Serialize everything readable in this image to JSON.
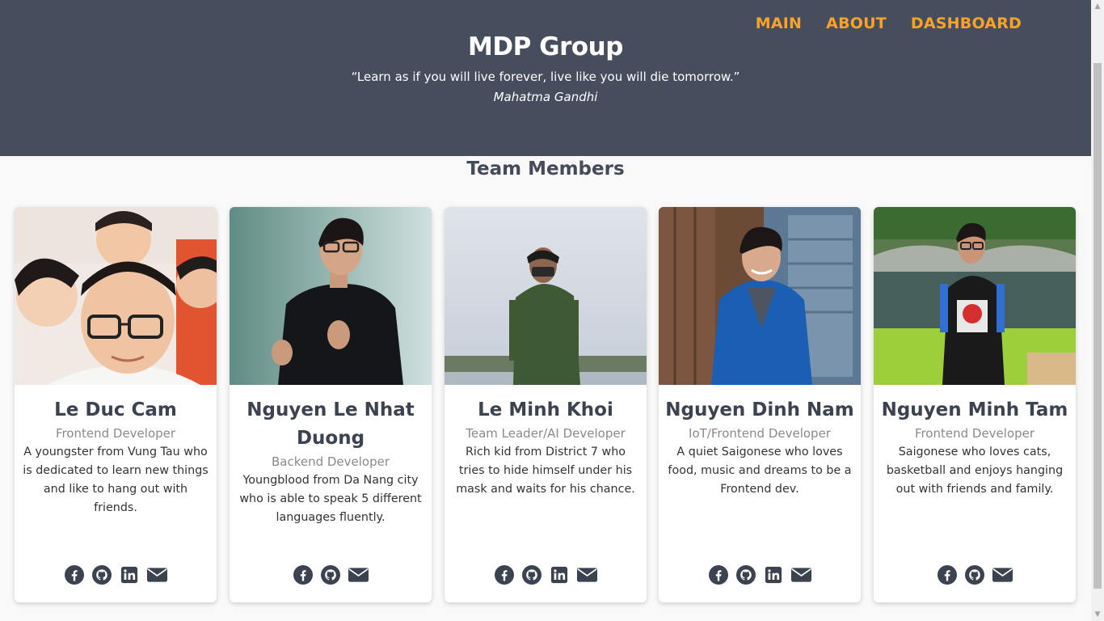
{
  "nav": {
    "items": [
      {
        "label": "MAIN"
      },
      {
        "label": "ABOUT"
      },
      {
        "label": "DASHBOARD"
      }
    ]
  },
  "header": {
    "title": "MDP Group",
    "quote": "“Learn as if you will live forever, live like you will die tomorrow.”",
    "author": "Mahatma Gandhi"
  },
  "team": {
    "title": "Team Members",
    "members": [
      {
        "name": "Le Duc Cam",
        "role": "Frontend Developer",
        "description": "A youngster from Vung Tau who is dedicated to learn new things and like to hang out with friends.",
        "socials": [
          "facebook-icon",
          "github-icon",
          "linkedin-icon",
          "email-icon"
        ]
      },
      {
        "name": "Nguyen Le Nhat Duong",
        "role": "Backend Developer",
        "description": "Youngblood from Da Nang city who is able to speak 5 different languages fluently.",
        "socials": [
          "facebook-icon",
          "github-icon",
          "email-icon"
        ]
      },
      {
        "name": "Le Minh Khoi",
        "role": "Team Leader/AI Developer",
        "description": "Rich kid from District 7 who tries to hide himself under his mask and waits for his chance.",
        "socials": [
          "facebook-icon",
          "github-icon",
          "linkedin-icon",
          "email-icon"
        ]
      },
      {
        "name": "Nguyen Dinh Nam",
        "role": "IoT/Frontend Developer",
        "description": "A quiet Saigonese who loves food, music and dreams to be a Frontend dev.",
        "socials": [
          "facebook-icon",
          "github-icon",
          "linkedin-icon",
          "email-icon"
        ]
      },
      {
        "name": "Nguyen Minh Tam",
        "role": "Frontend Developer",
        "description": "Saigonese who loves cats, basketball and enjoys hanging out with friends and family.",
        "socials": [
          "facebook-icon",
          "github-icon",
          "email-icon"
        ]
      }
    ]
  },
  "colors": {
    "header_bg": "#464d5d",
    "nav_accent": "#f7a32a",
    "page_bg": "#f9f9f9",
    "text_dark": "#3b4250",
    "role_gray": "#8a8a8a"
  }
}
